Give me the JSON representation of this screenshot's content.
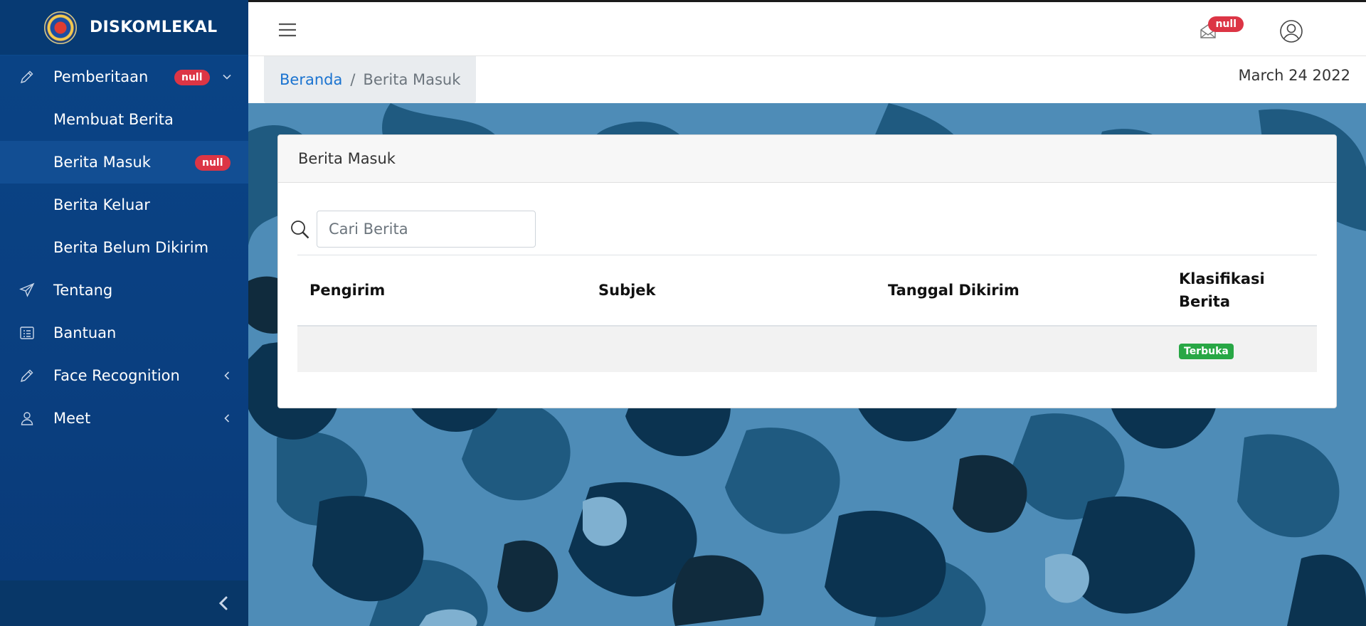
{
  "app": {
    "brand": "DISKOMLEKAL"
  },
  "sidebar": {
    "items": [
      {
        "label": "Pemberitaan",
        "badge": "null",
        "icon": "pencil-icon",
        "expandable": true
      },
      {
        "label": "Membuat Berita",
        "sub": true
      },
      {
        "label": "Berita Masuk",
        "sub": true,
        "active": true,
        "badge": "null"
      },
      {
        "label": "Berita Keluar",
        "sub": true
      },
      {
        "label": "Berita Belum Dikirim",
        "sub": true
      },
      {
        "label": "Tentang",
        "icon": "send-icon"
      },
      {
        "label": "Bantuan",
        "icon": "list-icon"
      },
      {
        "label": "Face Recognition",
        "icon": "pencil-icon",
        "expandable": true
      },
      {
        "label": "Meet",
        "icon": "user-icon",
        "expandable": true
      }
    ]
  },
  "topbar": {
    "mail_badge": "null"
  },
  "breadcrumb": {
    "home": "Beranda",
    "separator": "/",
    "current": "Berita Masuk"
  },
  "date": "March 24 2022",
  "card": {
    "title": "Berita Masuk",
    "search_placeholder": "Cari Berita",
    "columns": [
      "Pengirim",
      "Subjek",
      "Tanggal Dikirim",
      "Klasifikasi Berita"
    ],
    "rows": [
      {
        "pengirim": "",
        "subjek": "",
        "tanggal": "",
        "klasifikasi": "Terbuka"
      }
    ]
  },
  "colors": {
    "sidebar": "#0a4486",
    "accent_link": "#1a73d0",
    "badge_red": "#dc3545",
    "badge_green": "#28a745"
  }
}
